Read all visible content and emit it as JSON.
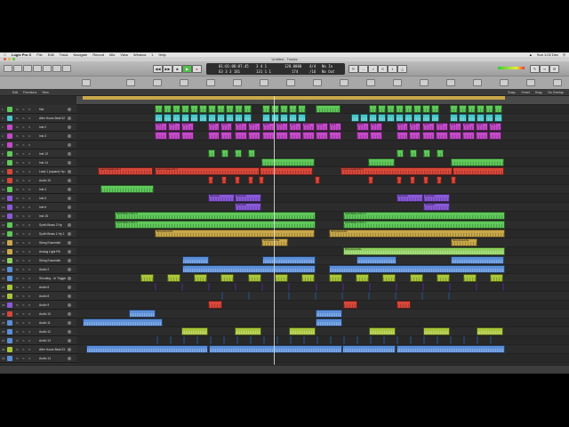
{
  "menubar": {
    "app": "Logic Pro X",
    "items": [
      "File",
      "Edit",
      "Track",
      "Navigate",
      "Record",
      "Mix",
      "View",
      "Window",
      "1",
      "Help"
    ],
    "clock": "Sun 1:02 Dec"
  },
  "window": {
    "title": "Untitled - Tracks"
  },
  "lcd": {
    "position": "01:01:08:07.45",
    "bars": "3 4 1",
    "bars_lower": "63 3 3 181",
    "bars_lower2": "131 1 1",
    "tempo": "120.0000",
    "tempo_lower": "174",
    "signature": "4/4",
    "signature_lower": "/16",
    "key": "No In",
    "key_lower": "No Out"
  },
  "localbar": {
    "edit": "Edit",
    "functions": "Functions",
    "view": "View",
    "snap_label": "Snap:",
    "snap": "Smart",
    "drag_label": "Drag:",
    "drag": "No Overlap"
  },
  "tracks": [
    {
      "num": "1",
      "name": "Hat"
    },
    {
      "num": "2",
      "name": "After Hours Beat 02"
    },
    {
      "num": "3",
      "name": "Inst 2"
    },
    {
      "num": "4",
      "name": "Inst 3"
    },
    {
      "num": "5",
      "name": ""
    },
    {
      "num": "6",
      "name": "Inst 13"
    },
    {
      "num": "7",
      "name": "Inst 14"
    },
    {
      "num": "8",
      "name": "Lead 1 (square) Hp 4"
    },
    {
      "num": "9",
      "name": "Audio 15"
    },
    {
      "num": "10",
      "name": "Inst 4"
    },
    {
      "num": "11",
      "name": "Inst 5"
    },
    {
      "num": "12",
      "name": "Inst 6"
    },
    {
      "num": "13",
      "name": "Inst 15"
    },
    {
      "num": "14",
      "name": "Synth Brass 2 Hp"
    },
    {
      "num": "15",
      "name": "Synth Brass 1 Hp 1"
    },
    {
      "num": "16",
      "name": "String Ensemble"
    },
    {
      "num": "17",
      "name": "Analog Light Pill"
    },
    {
      "num": "18",
      "name": "String Ensemble"
    },
    {
      "num": "19",
      "name": "Audio 2"
    },
    {
      "num": "20",
      "name": "Shooting ...in Trigger"
    },
    {
      "num": "21",
      "name": "Audio 6"
    },
    {
      "num": "22",
      "name": "Audio 8"
    },
    {
      "num": "23",
      "name": "Audio 9"
    },
    {
      "num": "24",
      "name": "Audio 10"
    },
    {
      "num": "25",
      "name": "Audio 11"
    },
    {
      "num": "26",
      "name": "Audio 12"
    },
    {
      "num": "27",
      "name": "Audio 13"
    },
    {
      "num": "28",
      "name": "After Hours Beat 03"
    },
    {
      "num": "29",
      "name": "Audio 14"
    },
    {
      "num": "30",
      "name": "Audio 16"
    }
  ],
  "region_labels": {
    "lead": "Lead 1 (square) Hp 4",
    "synth_brass_2": "Synth Brass 2 Hp 1 6",
    "synth_brass_1": "Synth Brass 1 Hp 1.1",
    "string": "String Ensemble",
    "inst": "Inst 3",
    "wavetalkr": "Wavetalkr"
  },
  "colors": {
    "green": "#5fc85a",
    "cyan": "#47c7c9",
    "magenta": "#c44ac9",
    "red": "#d7473a",
    "purple": "#8a5ad8",
    "yellowgreen": "#a9c63b",
    "olive": "#c9a84a",
    "blue": "#5a8ed8",
    "yellow": "#d6c640",
    "ltgreen": "#8fd060"
  }
}
